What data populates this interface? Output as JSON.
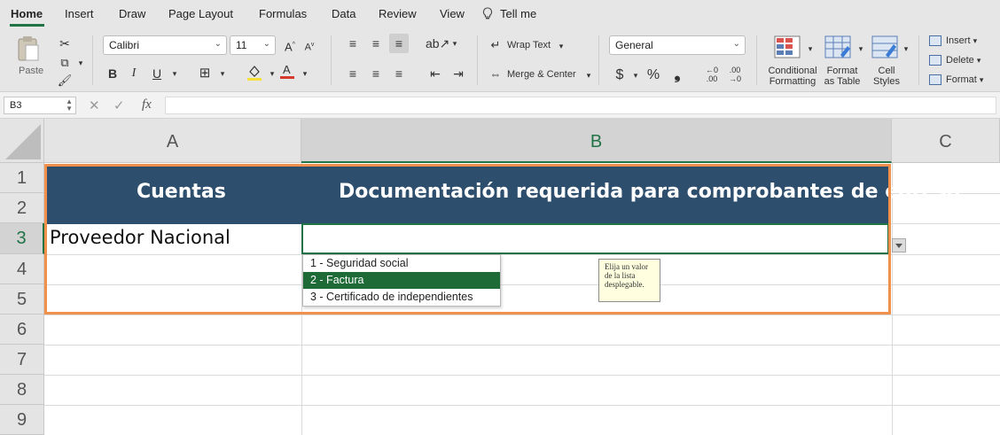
{
  "menu": {
    "tabs": [
      "Home",
      "Insert",
      "Draw",
      "Page Layout",
      "Formulas",
      "Data",
      "Review",
      "View"
    ],
    "tell_me": "Tell me",
    "active_tab": "Home"
  },
  "ribbon": {
    "paste_label": "Paste",
    "font_name": "Calibri",
    "font_size": "11",
    "bold": "B",
    "italic": "I",
    "underline": "U",
    "wrap_text": "Wrap Text",
    "merge_center": "Merge & Center",
    "number_format": "General",
    "currency": "$",
    "percent": "%",
    "comma": "❟",
    "conditional_formatting": [
      "Conditional",
      "Formatting"
    ],
    "format_as_table": [
      "Format",
      "as Table"
    ],
    "cell_styles": [
      "Cell",
      "Styles"
    ],
    "insert": "Insert",
    "delete": "Delete",
    "format": "Format"
  },
  "formula_bar": {
    "name_box": "B3",
    "fx": "fx",
    "formula": ""
  },
  "sheet": {
    "columns": [
      "A",
      "B",
      "C"
    ],
    "selected_column": "B",
    "rows": [
      "1",
      "2",
      "3",
      "4",
      "5",
      "6",
      "7",
      "8",
      "9"
    ],
    "selected_row": "3",
    "header_a": "Cuentas",
    "header_b": "Documentación requerida para comprobantes de egreso",
    "cell_a3": "Proveedor Nacional",
    "cell_b3": ""
  },
  "dropdown": {
    "options": [
      "1 - Seguridad social",
      "2 - Factura",
      "3 - Certificado de independientes"
    ],
    "highlighted_index": 1
  },
  "input_message": "Elija un valor de la lista desplegable.",
  "colors": {
    "accent_green": "#217346",
    "header_fill": "#2e4e6e",
    "table_border": "#f0904a",
    "selected_option": "#1e6b38",
    "tooltip_bg": "#ffffe0"
  }
}
